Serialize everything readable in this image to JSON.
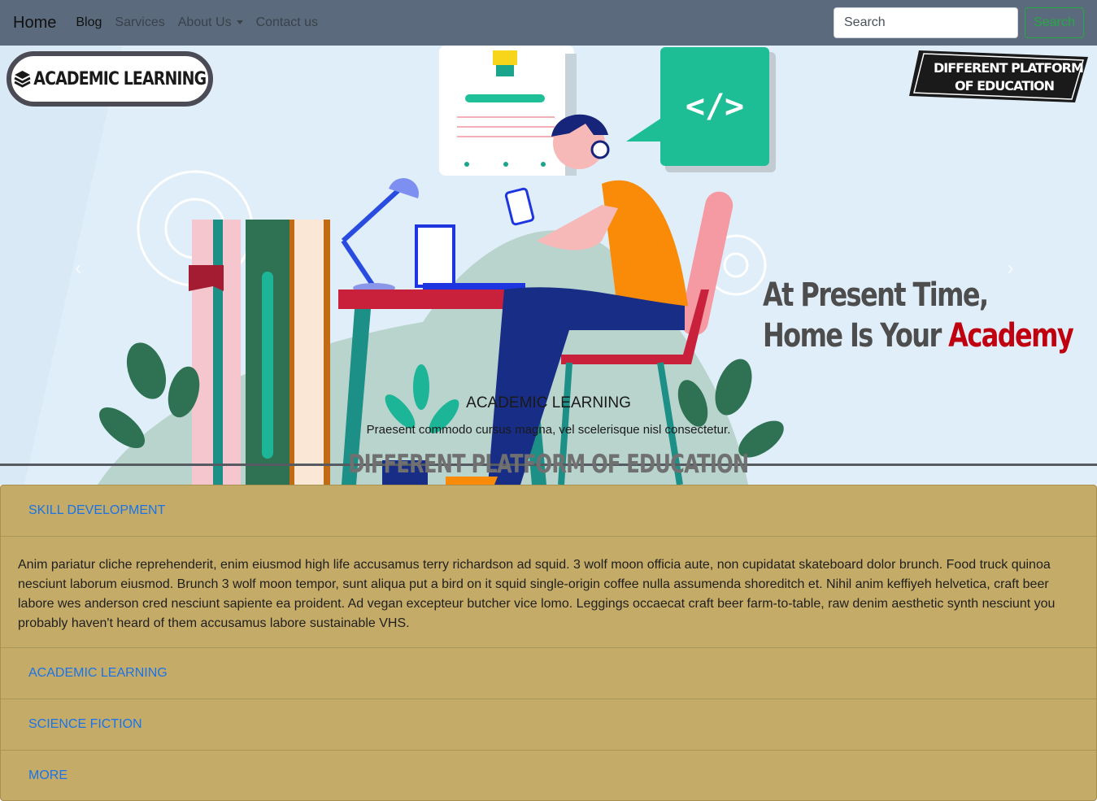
{
  "navbar": {
    "brand": "Home",
    "links": [
      {
        "label": "Blog"
      },
      {
        "label": "Sarvices"
      },
      {
        "label": "About Us"
      },
      {
        "label": "Contact us"
      }
    ],
    "search_placeholder": "Search",
    "search_button": "Search"
  },
  "hero": {
    "logo_text": "ACADEMIC LEARNING",
    "tagline_line1": "DIFFERENT PLATFORM",
    "tagline_line2": "OF EDUCATION",
    "headline_line1": "At Present Time,",
    "headline_line2_part1": "Home Is Your ",
    "headline_line2_accent": "Academy",
    "caption_title": "ACADEMIC LEARNING",
    "caption_text": "Praesent commodo cursus magna, vel scelerisque nisl consectetur.",
    "prev_icon": "‹",
    "next_icon": "›",
    "divider_title": "DIFFERENT PLATFORM OF EDUCATION"
  },
  "accordion": {
    "items": [
      {
        "title": "SKILL DEVELOPMENT"
      },
      {
        "title": "ACADEMIC LEARNING"
      },
      {
        "title": "SCIENCE FICTION"
      },
      {
        "title": "MORE"
      }
    ],
    "open_body": "Anim pariatur cliche reprehenderit, enim eiusmod high life accusamus terry richardson ad squid. 3 wolf moon officia aute, non cupidatat skateboard dolor brunch. Food truck quinoa nesciunt laborum eiusmod. Brunch 3 wolf moon tempor, sunt aliqua put a bird on it squid single-origin coffee nulla assumenda shoreditch et. Nihil anim keffiyeh helvetica, craft beer labore wes anderson cred nesciunt sapiente ea proident. Ad vegan excepteur butcher vice lomo. Leggings occaecat craft beer farm-to-table, raw denim aesthetic synth nesciunt you probably haven't heard of them accusamus labore sustainable VHS."
  },
  "colors": {
    "navbar_bg": "#5b6b7d",
    "hero_bg": "#d9eaf6",
    "accent_red": "#c0000f",
    "accordion_bg": "#c4ab67",
    "link_blue": "#1a73e8",
    "search_green": "#28a745"
  },
  "icons": {
    "logo_icon": "stack-of-books-icon",
    "tag_icon": "pen-icon",
    "prev": "chevron-left-icon",
    "next": "chevron-right-icon",
    "code_icon": "code-icon",
    "bulb_icon": "lightbulb-icon"
  }
}
